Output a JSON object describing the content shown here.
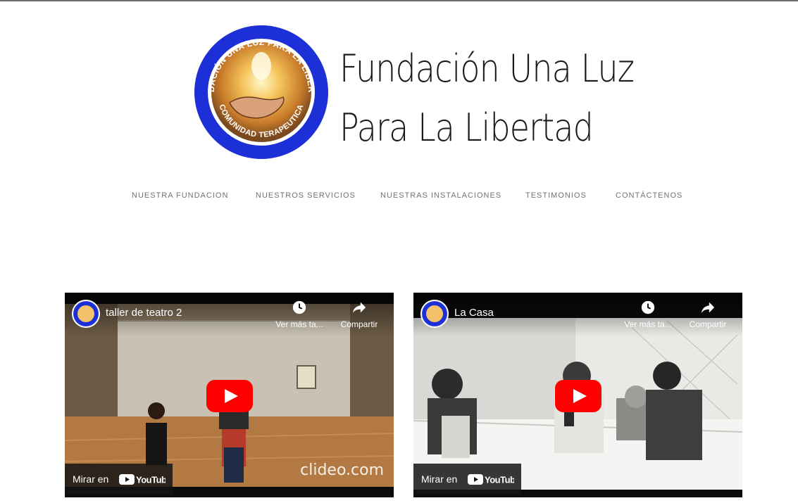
{
  "brand": {
    "title_line1": "Fundación Una Luz",
    "title_line2": "Para La Libertad",
    "logo_ring_top": "FUNDACIÓN UNA LUZ PARA LA LIBERTAD",
    "logo_ring_bottom": "COMUNIDAD TERAPEUTICA"
  },
  "nav": {
    "items": [
      {
        "label": "NUESTRA FUNDACION"
      },
      {
        "label": "NUESTROS SERVICIOS"
      },
      {
        "label": "NUESTRAS INSTALACIONES"
      },
      {
        "label": "TESTIMONIOS"
      },
      {
        "label": "CONTÁCTENOS"
      }
    ]
  },
  "videos": [
    {
      "title": "taller de teatro 2",
      "watch_later": "Ver más ta...",
      "share": "Compartir",
      "watch_on": "Mirar en",
      "youtube": "YouTube",
      "watermark": "clideo.com"
    },
    {
      "title": "La Casa",
      "watch_later": "Ver más ta...",
      "share": "Compartir",
      "watch_on": "Mirar en",
      "youtube": "YouTube"
    }
  ],
  "colors": {
    "logo_blue": "#1d2fd6",
    "nav_text": "#6f7479",
    "youtube_red": "#ff0000"
  }
}
